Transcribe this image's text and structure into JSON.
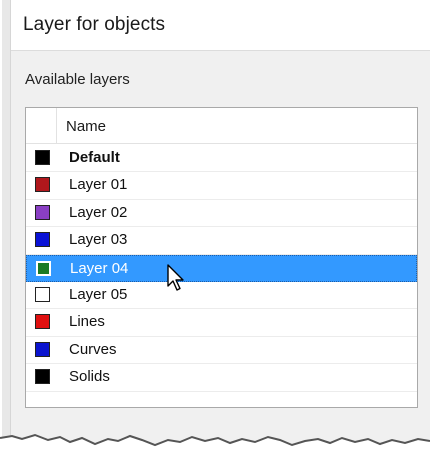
{
  "dialog": {
    "title": "Layer for objects",
    "section_label": "Available layers"
  },
  "list": {
    "header": {
      "name": "Name"
    },
    "rows": [
      {
        "label": "Default",
        "color": "#000000",
        "bold": true,
        "selected": false
      },
      {
        "label": "Layer 01",
        "color": "#b0171c",
        "bold": false,
        "selected": false
      },
      {
        "label": "Layer 02",
        "color": "#8a3fc4",
        "bold": false,
        "selected": false
      },
      {
        "label": "Layer 03",
        "color": "#0a12d6",
        "bold": false,
        "selected": false
      },
      {
        "label": "Layer 04",
        "color": "#1b7a24",
        "bold": false,
        "selected": true
      },
      {
        "label": "Layer 05",
        "color": "#ffffff",
        "bold": false,
        "selected": false
      },
      {
        "label": "Lines",
        "color": "#e01010",
        "bold": false,
        "selected": false
      },
      {
        "label": "Curves",
        "color": "#0b14cf",
        "bold": false,
        "selected": false
      },
      {
        "label": "Solids",
        "color": "#000000",
        "bold": false,
        "selected": false
      }
    ]
  },
  "colors": {
    "selection": "#3399ff",
    "window_bg": "#f0f0f0"
  }
}
